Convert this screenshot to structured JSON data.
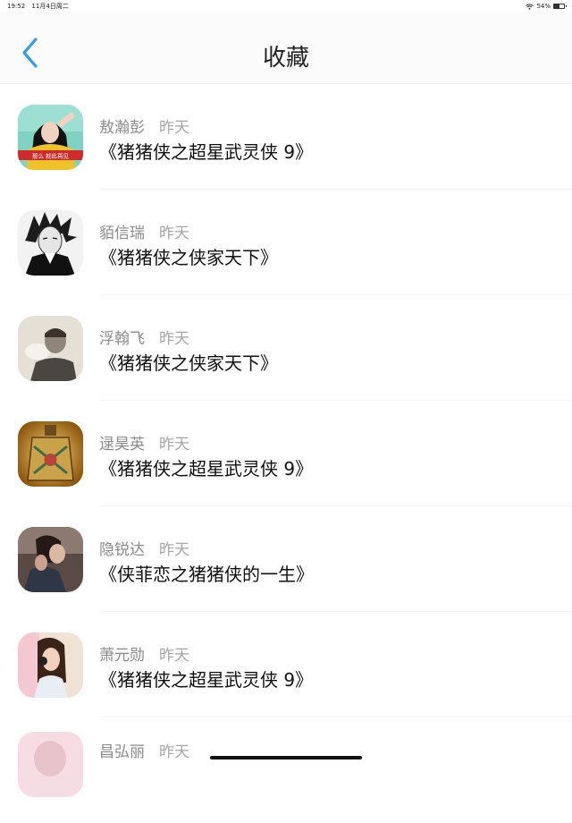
{
  "status": {
    "time": "19:52",
    "date": "11月4日周二",
    "battery": "54%",
    "battery_level": 0.54,
    "wifi_icon": "wifi-icon"
  },
  "nav": {
    "title": "收藏",
    "back_icon": "chevron-left-icon"
  },
  "colors": {
    "accent": "#2a9df4"
  },
  "favorites": [
    {
      "name": "敖瀚彭",
      "time": "昨天",
      "title": "《猪猪侠之超星武灵侠 9》",
      "avatar_caption": "那么  就此再见"
    },
    {
      "name": "貊信瑞",
      "time": "昨天",
      "title": "《猪猪侠之侠家天下》"
    },
    {
      "name": "浮翰飞",
      "time": "昨天",
      "title": "《猪猪侠之侠家天下》"
    },
    {
      "name": "逯昊英",
      "time": "昨天",
      "title": "《猪猪侠之超星武灵侠 9》"
    },
    {
      "name": "隐锐达",
      "time": "昨天",
      "title": "《侠菲恋之猪猪侠的一生》"
    },
    {
      "name": "萧元勋",
      "time": "昨天",
      "title": "《猪猪侠之超星武灵侠 9》"
    },
    {
      "name": "昌弘丽",
      "time": "昨天",
      "title": ""
    }
  ]
}
